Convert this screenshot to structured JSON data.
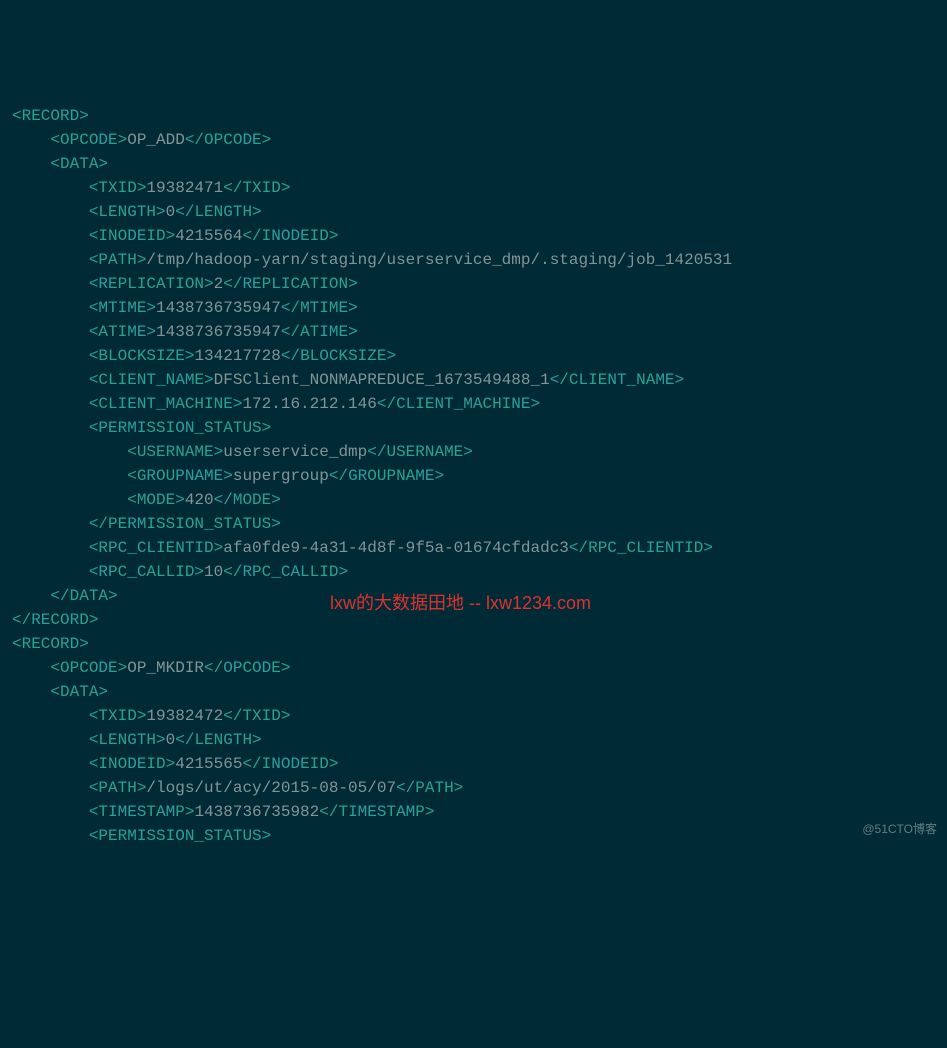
{
  "xml": {
    "record1": {
      "opcode": "OP_ADD",
      "txid": "19382471",
      "length": "0",
      "inodeid": "4215564",
      "path": "/tmp/hadoop-yarn/staging/userservice_dmp/.staging/job_1420531",
      "replication": "2",
      "mtime": "1438736735947",
      "atime": "1438736735947",
      "blocksize": "134217728",
      "client_name": "DFSClient_NONMAPREDUCE_1673549488_1",
      "client_machine": "172.16.212.146",
      "username": "userservice_dmp",
      "groupname": "supergroup",
      "mode": "420",
      "rpc_clientid": "afa0fde9-4a31-4d8f-9f5a-01674cfdadc3",
      "rpc_callid": "10"
    },
    "record2": {
      "opcode": "OP_MKDIR",
      "txid": "19382472",
      "length": "0",
      "inodeid": "4215565",
      "path": "/logs/ut/acy/2015-08-05/07",
      "timestamp": "1438736735982"
    }
  },
  "watermark": "lxw的大数据田地 -- lxw1234.com",
  "corner": "@51CTO博客",
  "tags": {
    "RECORD_O": "<RECORD>",
    "RECORD_C": "</RECORD>",
    "OPCODE_O": "<OPCODE>",
    "OPCODE_C": "</OPCODE>",
    "DATA_O": "<DATA>",
    "DATA_C": "</DATA>",
    "TXID_O": "<TXID>",
    "TXID_C": "</TXID>",
    "LENGTH_O": "<LENGTH>",
    "LENGTH_C": "</LENGTH>",
    "INODEID_O": "<INODEID>",
    "INODEID_C": "</INODEID>",
    "PATH_O": "<PATH>",
    "PATH_C": "</PATH>",
    "REPLICATION_O": "<REPLICATION>",
    "REPLICATION_C": "</REPLICATION>",
    "MTIME_O": "<MTIME>",
    "MTIME_C": "</MTIME>",
    "ATIME_O": "<ATIME>",
    "ATIME_C": "</ATIME>",
    "BLOCKSIZE_O": "<BLOCKSIZE>",
    "BLOCKSIZE_C": "</BLOCKSIZE>",
    "CLIENT_NAME_O": "<CLIENT_NAME>",
    "CLIENT_NAME_C": "</CLIENT_NAME>",
    "CLIENT_MACHINE_O": "<CLIENT_MACHINE>",
    "CLIENT_MACHINE_C": "</CLIENT_MACHINE>",
    "PERMISSION_STATUS_O": "<PERMISSION_STATUS>",
    "PERMISSION_STATUS_C": "</PERMISSION_STATUS>",
    "USERNAME_O": "<USERNAME>",
    "USERNAME_C": "</USERNAME>",
    "GROUPNAME_O": "<GROUPNAME>",
    "GROUPNAME_C": "</GROUPNAME>",
    "MODE_O": "<MODE>",
    "MODE_C": "</MODE>",
    "RPC_CLIENTID_O": "<RPC_CLIENTID>",
    "RPC_CLIENTID_C": "</RPC_CLIENTID>",
    "RPC_CALLID_O": "<RPC_CALLID>",
    "RPC_CALLID_C": "</RPC_CALLID>",
    "TIMESTAMP_O": "<TIMESTAMP>",
    "TIMESTAMP_C": "</TIMESTAMP>"
  }
}
